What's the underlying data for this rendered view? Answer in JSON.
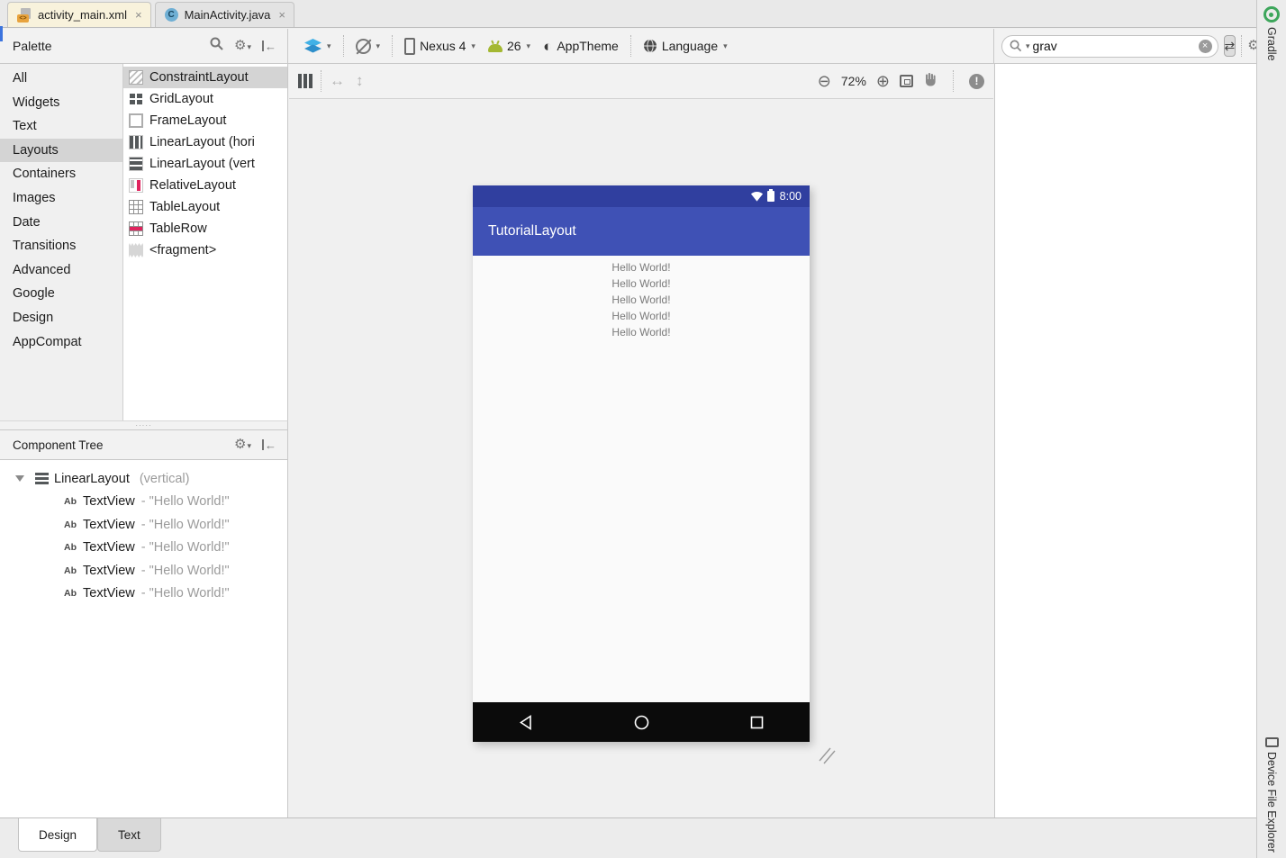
{
  "editor_tabs": {
    "tabs": [
      {
        "label": "activity_main.xml",
        "icon": "xml-file-icon",
        "close": "×",
        "selected": true
      },
      {
        "label": "MainActivity.java",
        "icon": "class-icon",
        "class_letter": "C",
        "close": "×",
        "selected": false
      }
    ]
  },
  "palette": {
    "title": "Palette",
    "categories": [
      "All",
      "Widgets",
      "Text",
      "Layouts",
      "Containers",
      "Images",
      "Date",
      "Transitions",
      "Advanced",
      "Google",
      "Design",
      "AppCompat"
    ],
    "selected_category": "Layouts",
    "items": [
      {
        "label": "ConstraintLayout",
        "icon": "constraint-layout-icon",
        "selected": true
      },
      {
        "label": "GridLayout",
        "icon": "grid-layout-icon"
      },
      {
        "label": "FrameLayout",
        "icon": "frame-layout-icon"
      },
      {
        "label": "LinearLayout (hori",
        "icon": "linear-layout-horizontal-icon"
      },
      {
        "label": "LinearLayout (vert",
        "icon": "linear-layout-vertical-icon"
      },
      {
        "label": "RelativeLayout",
        "icon": "relative-layout-icon"
      },
      {
        "label": "TableLayout",
        "icon": "table-layout-icon"
      },
      {
        "label": "TableRow",
        "icon": "table-row-icon"
      },
      {
        "label": "<fragment>",
        "icon": "fragment-icon"
      }
    ]
  },
  "config_toolbar": {
    "device": "Nexus 4",
    "api_level": "26",
    "theme": "AppTheme",
    "language": "Language",
    "icons": [
      "layers-icon",
      "orientation-icon",
      "phone-icon",
      "android-icon",
      "theme-icon",
      "globe-icon"
    ]
  },
  "search": {
    "value": "grav",
    "icons": [
      "search-icon",
      "clear-icon",
      "swap-icon",
      "gear-icon",
      "dock-right-icon"
    ]
  },
  "design_toolbar": {
    "zoom": "72%",
    "icons": [
      "linear-layout-icon",
      "width-arrow-icon",
      "height-arrow-icon",
      "zoom-out-icon",
      "zoom-in-icon",
      "fit-screen-icon",
      "pan-icon",
      "warnings-icon"
    ]
  },
  "component_tree": {
    "title": "Component Tree",
    "root": {
      "label": "LinearLayout",
      "meta": "(vertical)"
    },
    "children": [
      {
        "badge": "Ab",
        "type": "TextView",
        "value": "- \"Hello World!\""
      },
      {
        "badge": "Ab",
        "type": "TextView",
        "value": "- \"Hello World!\""
      },
      {
        "badge": "Ab",
        "type": "TextView",
        "value": "- \"Hello World!\""
      },
      {
        "badge": "Ab",
        "type": "TextView",
        "value": "- \"Hello World!\""
      },
      {
        "badge": "Ab",
        "type": "TextView",
        "value": "- \"Hello World!\""
      }
    ]
  },
  "preview": {
    "status_time": "8:00",
    "app_bar_title": "TutorialLayout",
    "lines": [
      "Hello World!",
      "Hello World!",
      "Hello World!",
      "Hello World!",
      "Hello World!"
    ],
    "nav_icons": [
      "back-icon",
      "home-icon",
      "recents-icon"
    ]
  },
  "bottom_tabs": {
    "tabs": [
      "Design",
      "Text"
    ],
    "selected": "Design"
  },
  "right_bar": {
    "top": "Gradle",
    "bottom": "Device File Explorer"
  },
  "colors": {
    "status_bar_indigo": "#303F9F",
    "app_bar_indigo": "#3F51B5",
    "palette_pink": "#E0245E",
    "android_green": "#A4B832",
    "layers_blue": "#39A7DE",
    "selected_tab_cream": "#F8F2DC",
    "selection_gray": "#D4D4D4",
    "gradle_green": "#3DA65B"
  }
}
